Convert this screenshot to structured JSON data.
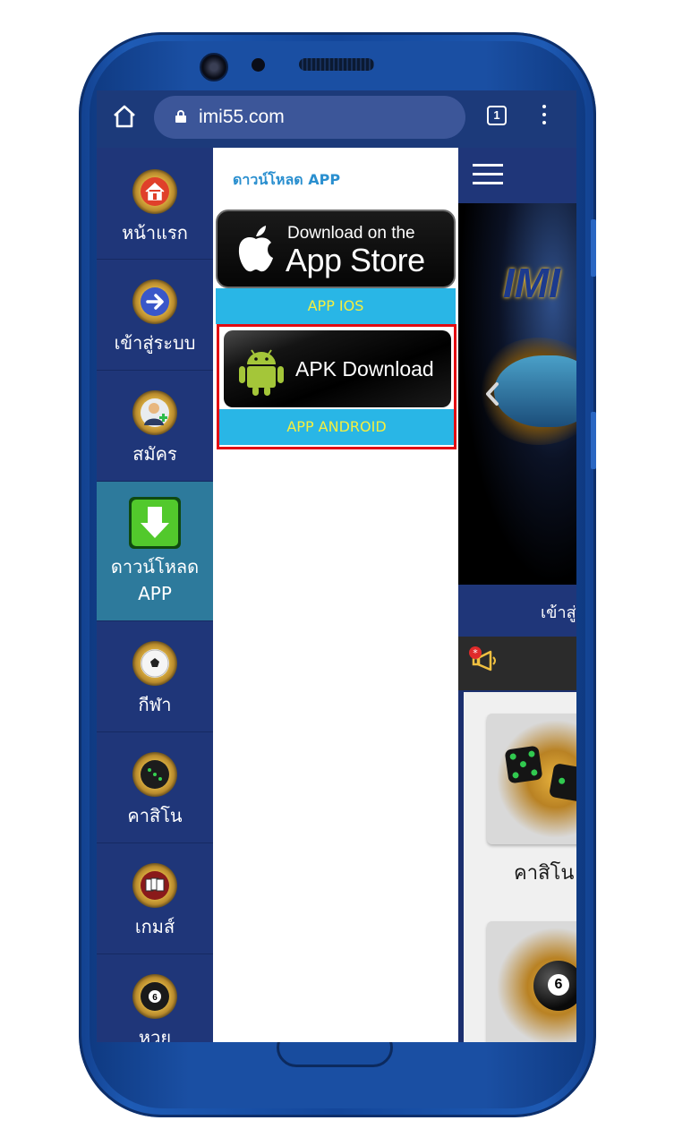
{
  "browser": {
    "url": "imi55.com",
    "tab_count": "1"
  },
  "sidebar": {
    "items": [
      {
        "label": "หน้าแรก",
        "icon": "home-icon"
      },
      {
        "label": "เข้าสู่ระบบ",
        "icon": "login-arrow-icon"
      },
      {
        "label": "สมัคร",
        "icon": "register-user-icon"
      },
      {
        "label": "ดาวน์โหลด APP",
        "icon": "download-icon",
        "active": true
      },
      {
        "label": "กีฬา",
        "icon": "soccer-ball-icon"
      },
      {
        "label": "คาสิโน",
        "icon": "dice-icon"
      },
      {
        "label": "เกมส์",
        "icon": "cards-icon"
      },
      {
        "label": "หวย",
        "icon": "lottery-ball-icon"
      }
    ]
  },
  "download_panel": {
    "title": "ดาวน์โหลด APP",
    "appstore_small": "Download on the",
    "appstore_big": "App Store",
    "ios_caption": "APP IOS",
    "apk_label": "APK Download",
    "android_caption": "APP ANDROID"
  },
  "site": {
    "login_text": "เข้าสู่ระบบ",
    "banner_logo": "IMI",
    "game_cards": [
      {
        "label": "คาสิโน",
        "icon": "dice-icon"
      },
      {
        "label": "",
        "icon": "billiard-ball-icon"
      }
    ]
  },
  "colors": {
    "nav_bg": "#1f3679",
    "nav_active": "#2d7a9c",
    "caption_bar": "#29b6e6",
    "caption_text": "#f6ef3e",
    "highlight_border": "#e30b12",
    "title_blue": "#2a8fcf"
  }
}
